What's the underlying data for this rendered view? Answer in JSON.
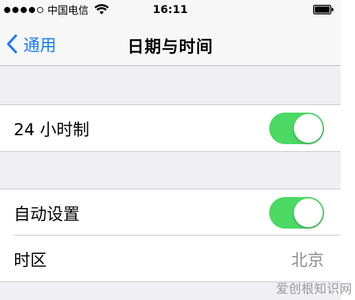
{
  "status_bar": {
    "carrier": "中国电信",
    "time": "16:11"
  },
  "nav": {
    "back_label": "通用",
    "title": "日期与时间"
  },
  "groups": {
    "clock": {
      "label": "24 小时制",
      "toggle_on": true
    },
    "auto": {
      "auto_label": "自动设置",
      "auto_toggle_on": true,
      "timezone_label": "时区",
      "timezone_value": "北京"
    }
  },
  "watermark": "爱创根知识网",
  "colors": {
    "accent": "#1a7cf5",
    "toggle_on": "#4cd964",
    "background": "#efeff4"
  }
}
